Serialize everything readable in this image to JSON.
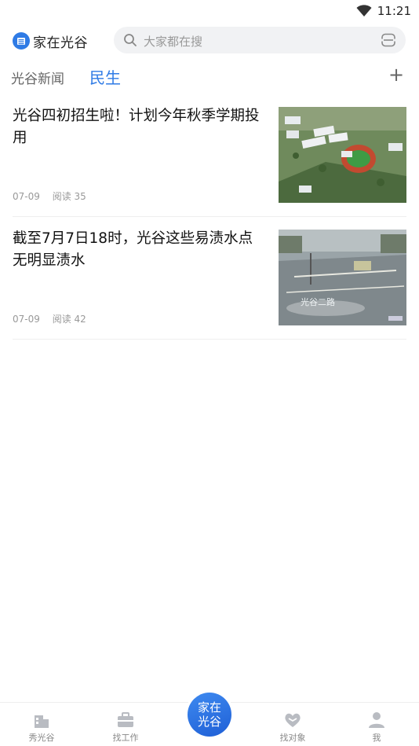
{
  "status_bar": {
    "time": "11:21"
  },
  "header": {
    "app_name": "家在光谷",
    "search_placeholder": "大家都在搜"
  },
  "tabs": [
    {
      "label": "光谷新闻",
      "active": false
    },
    {
      "label": "民生",
      "active": true
    }
  ],
  "tab_add_label": "+",
  "news": [
    {
      "title": "光谷四初招生啦！计划今年秋季学期投用",
      "date": "07-09",
      "reads": "阅读 35",
      "thumb_caption": ""
    },
    {
      "title": "截至7月7日18时，光谷这些易渍水点无明显渍水",
      "date": "07-09",
      "reads": "阅读 42",
      "thumb_caption": "光谷二路"
    }
  ],
  "bottom_nav": [
    {
      "label": "秀光谷",
      "icon": "building-icon"
    },
    {
      "label": "找工作",
      "icon": "briefcase-icon"
    },
    {
      "label": "家在光谷",
      "icon": "home-center-button"
    },
    {
      "label": "找对象",
      "icon": "heart-icon"
    },
    {
      "label": "我",
      "icon": "user-icon"
    }
  ],
  "center_button": {
    "line1": "家在",
    "line2": "光谷"
  },
  "colors": {
    "accent": "#2f7be5",
    "text": "#222222",
    "muted": "#999999"
  }
}
